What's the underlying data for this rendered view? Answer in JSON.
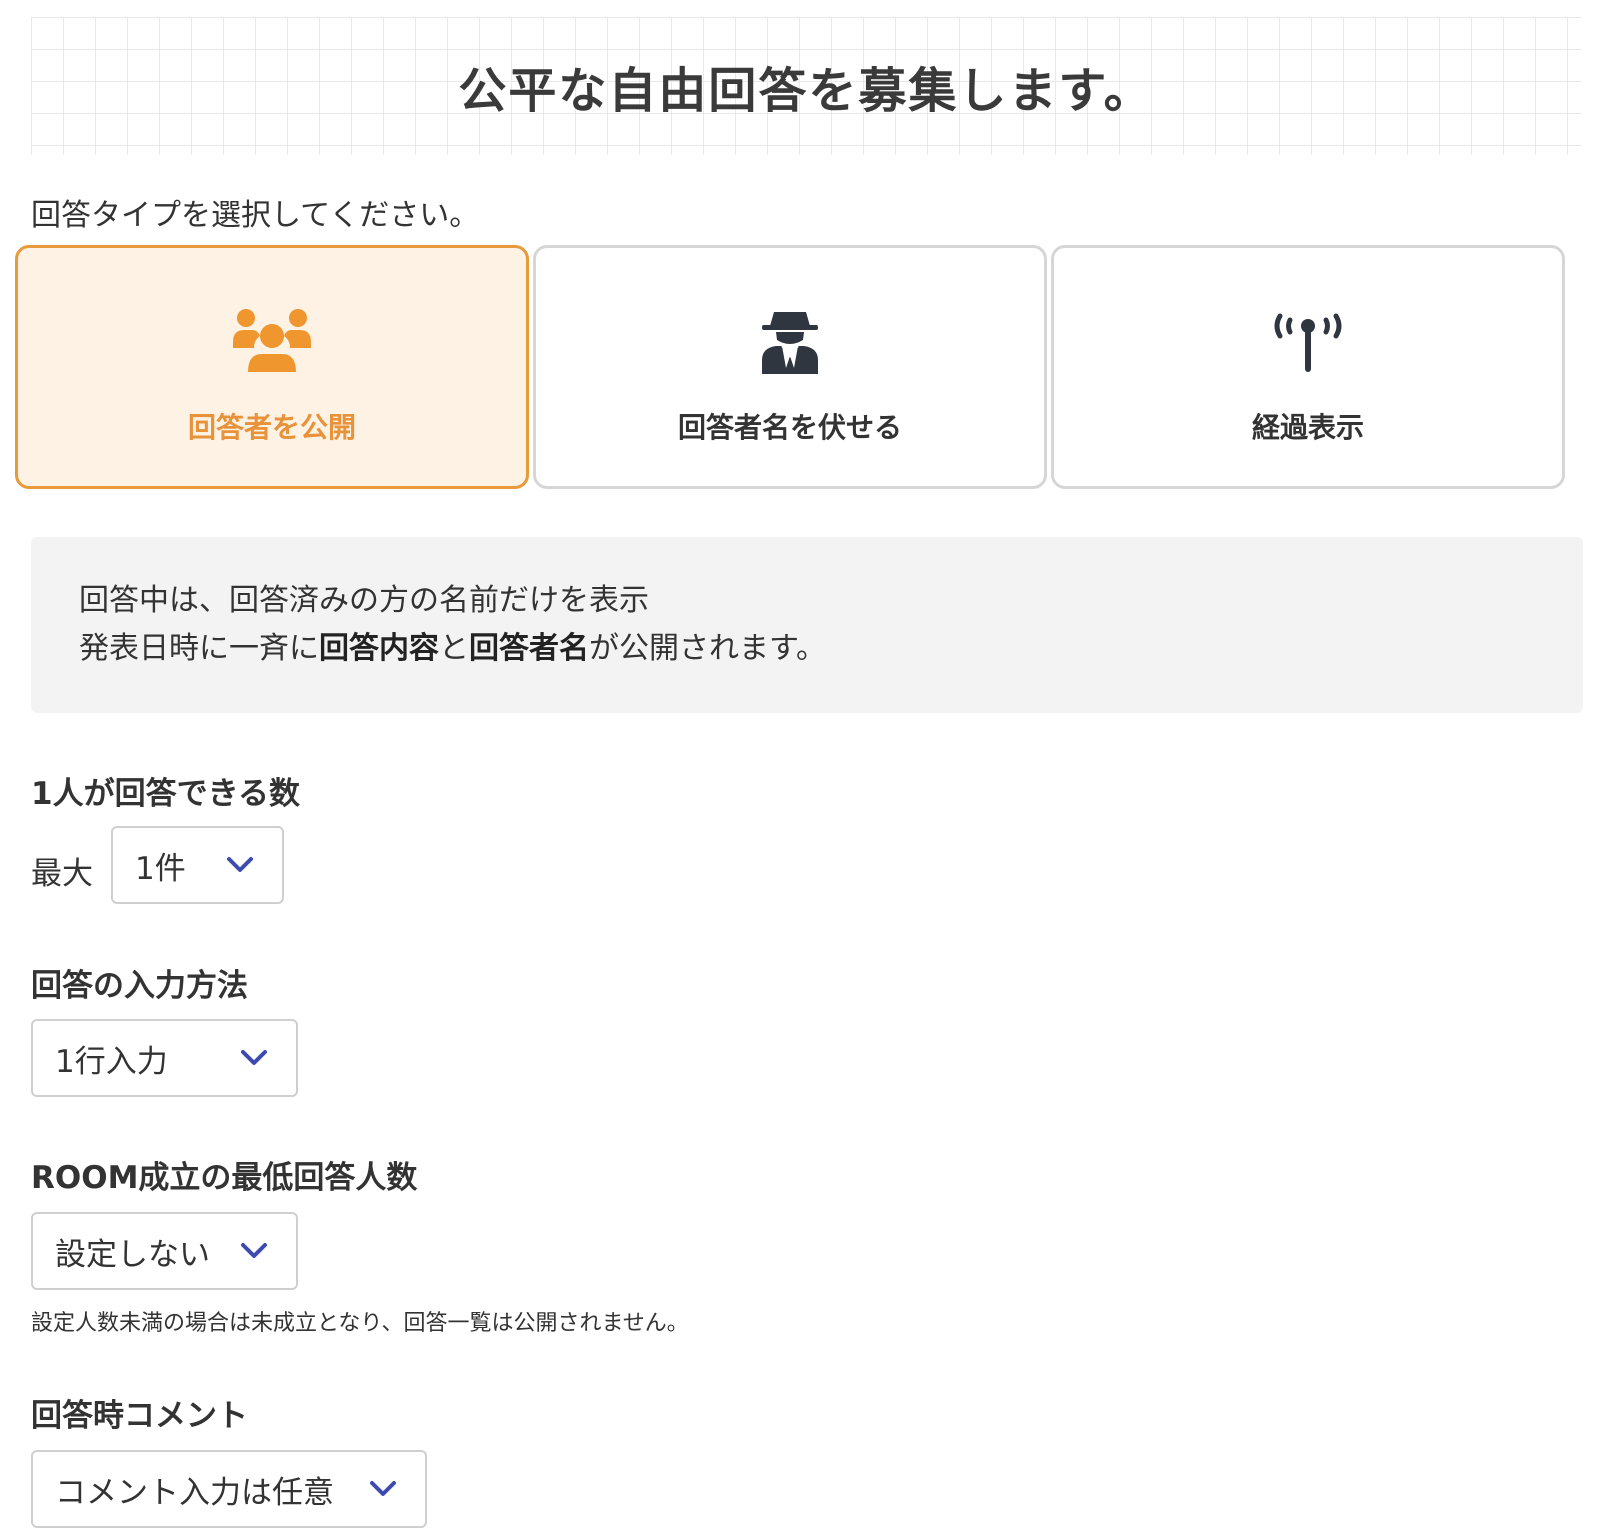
{
  "header": {
    "title": "公平な自由回答を募集します。"
  },
  "answer_type": {
    "prompt": "回答タイプを選択してください。",
    "options": [
      {
        "label": "回答者を公開",
        "icon": "group-icon",
        "selected": true
      },
      {
        "label": "回答者名を伏せる",
        "icon": "incognito-icon",
        "selected": false
      },
      {
        "label": "経過表示",
        "icon": "broadcast-tower-icon",
        "selected": false
      }
    ]
  },
  "info": {
    "line1": "回答中は、回答済みの方の名前だけを表示",
    "line2_a": "発表日時に一斉に",
    "line2_b": "回答内容",
    "line2_c": "と",
    "line2_d": "回答者名",
    "line2_e": "が公開されます。"
  },
  "per_person": {
    "title": "1人が回答できる数",
    "prefix": "最大",
    "value": "1件"
  },
  "input_method": {
    "title": "回答の入力方法",
    "value": "1行入力"
  },
  "min_respondents": {
    "title": "ROOM成立の最低回答人数",
    "value": "設定しない",
    "note": "設定人数未満の場合は未成立となり、回答一覧は公開されません。"
  },
  "comment": {
    "title": "回答時コメント",
    "value": "コメント入力は任意"
  },
  "colors": {
    "accent": "#e8923a",
    "accent_bg": "#fdf2e3",
    "chevron": "#3d4bb0",
    "icon_dark": "#2f3640"
  }
}
